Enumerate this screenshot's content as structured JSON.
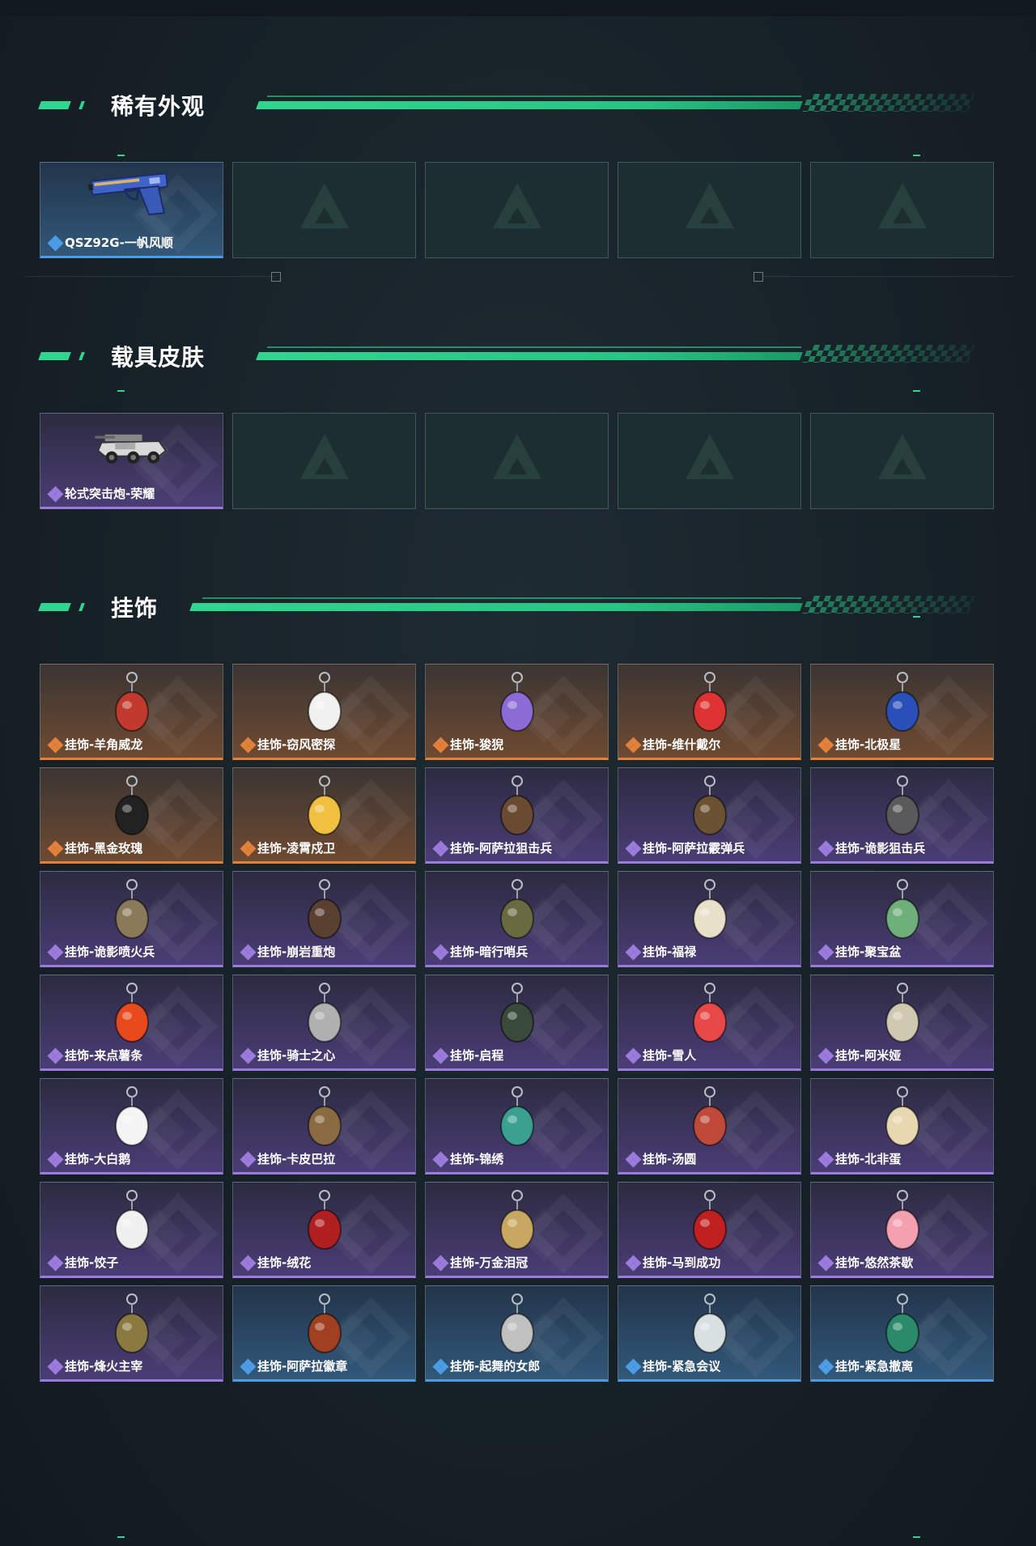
{
  "sections": [
    {
      "title": "稀有外观",
      "items": [
        {
          "label": "QSZ92G-一帆风顺",
          "rarity": "blue",
          "icon": "pistol-icon"
        },
        {
          "label": "",
          "rarity": "empty"
        },
        {
          "label": "",
          "rarity": "empty"
        },
        {
          "label": "",
          "rarity": "empty"
        },
        {
          "label": "",
          "rarity": "empty"
        }
      ]
    },
    {
      "title": "载具皮肤",
      "items": [
        {
          "label": "轮式突击炮-荣耀",
          "rarity": "purple",
          "icon": "armored-vehicle-icon"
        },
        {
          "label": "",
          "rarity": "empty"
        },
        {
          "label": "",
          "rarity": "empty"
        },
        {
          "label": "",
          "rarity": "empty"
        },
        {
          "label": "",
          "rarity": "empty"
        }
      ]
    },
    {
      "title": "挂饰",
      "items": [
        {
          "label": "挂饰-羊角威龙",
          "rarity": "orange",
          "icon": "charm-icon"
        },
        {
          "label": "挂饰-窃风密探",
          "rarity": "orange",
          "icon": "charm-icon"
        },
        {
          "label": "挂饰-狻猊",
          "rarity": "orange",
          "icon": "charm-icon"
        },
        {
          "label": "挂饰-维什戴尔",
          "rarity": "orange",
          "icon": "charm-icon"
        },
        {
          "label": "挂饰-北极星",
          "rarity": "orange",
          "icon": "charm-icon"
        },
        {
          "label": "挂饰-黑金玫瑰",
          "rarity": "orange",
          "icon": "charm-icon"
        },
        {
          "label": "挂饰-凌霄戍卫",
          "rarity": "orange",
          "icon": "charm-icon"
        },
        {
          "label": "挂饰-阿萨拉狙击兵",
          "rarity": "purple",
          "icon": "charm-icon"
        },
        {
          "label": "挂饰-阿萨拉霰弹兵",
          "rarity": "purple",
          "icon": "charm-icon"
        },
        {
          "label": "挂饰-诡影狙击兵",
          "rarity": "purple",
          "icon": "charm-icon"
        },
        {
          "label": "挂饰-诡影喷火兵",
          "rarity": "purple",
          "icon": "charm-icon"
        },
        {
          "label": "挂饰-崩岩重炮",
          "rarity": "purple",
          "icon": "charm-icon"
        },
        {
          "label": "挂饰-暗行哨兵",
          "rarity": "purple",
          "icon": "charm-icon"
        },
        {
          "label": "挂饰-福禄",
          "rarity": "purple",
          "icon": "charm-icon"
        },
        {
          "label": "挂饰-聚宝盆",
          "rarity": "purple",
          "icon": "charm-icon"
        },
        {
          "label": "挂饰-来点薯条",
          "rarity": "purple",
          "icon": "charm-icon"
        },
        {
          "label": "挂饰-骑士之心",
          "rarity": "purple",
          "icon": "charm-icon"
        },
        {
          "label": "挂饰-启程",
          "rarity": "purple",
          "icon": "charm-icon"
        },
        {
          "label": "挂饰-雪人",
          "rarity": "purple",
          "icon": "charm-icon"
        },
        {
          "label": "挂饰-阿米娅",
          "rarity": "purple",
          "icon": "charm-icon"
        },
        {
          "label": "挂饰-大白鹅",
          "rarity": "purple",
          "icon": "charm-icon"
        },
        {
          "label": "挂饰-卡皮巴拉",
          "rarity": "purple",
          "icon": "charm-icon"
        },
        {
          "label": "挂饰-锦绣",
          "rarity": "purple",
          "icon": "charm-icon"
        },
        {
          "label": "挂饰-汤圆",
          "rarity": "purple",
          "icon": "charm-icon"
        },
        {
          "label": "挂饰-北非蛋",
          "rarity": "purple",
          "icon": "charm-icon"
        },
        {
          "label": "挂饰-饺子",
          "rarity": "purple",
          "icon": "charm-icon"
        },
        {
          "label": "挂饰-绒花",
          "rarity": "purple",
          "icon": "charm-icon"
        },
        {
          "label": "挂饰-万金泪冠",
          "rarity": "purple",
          "icon": "charm-icon"
        },
        {
          "label": "挂饰-马到成功",
          "rarity": "purple",
          "icon": "charm-icon"
        },
        {
          "label": "挂饰-悠然茶歇",
          "rarity": "purple",
          "icon": "charm-icon"
        },
        {
          "label": "挂饰-烽火主宰",
          "rarity": "purple",
          "icon": "charm-icon"
        },
        {
          "label": "挂饰-阿萨拉徽章",
          "rarity": "blue",
          "icon": "charm-icon"
        },
        {
          "label": "挂饰-起舞的女郎",
          "rarity": "blue",
          "icon": "charm-icon"
        },
        {
          "label": "挂饰-紧急会议",
          "rarity": "blue",
          "icon": "charm-icon"
        },
        {
          "label": "挂饰-紧急撤离",
          "rarity": "blue",
          "icon": "charm-icon"
        }
      ]
    }
  ],
  "colors": {
    "accent": "#2fd68f",
    "orange": "#e3803a",
    "purple": "#9b7cde",
    "blue": "#4c9ce6"
  }
}
